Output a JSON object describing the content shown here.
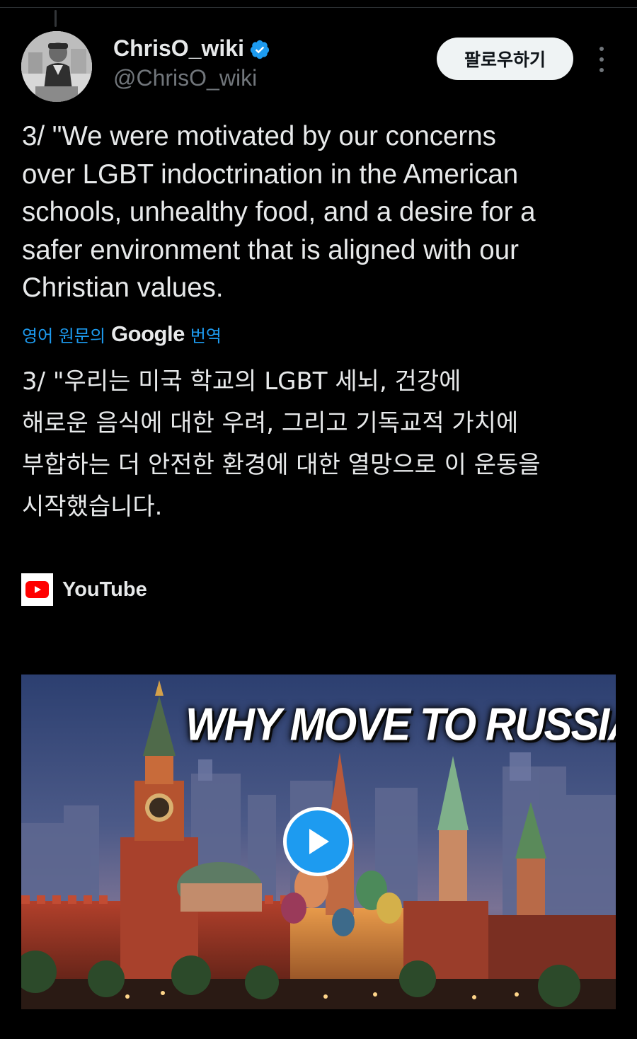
{
  "author": {
    "name": "ChrisO_wiki",
    "handle": "@ChrisO_wiki",
    "verified": true
  },
  "actions": {
    "follow_label": "팔로우하기",
    "more_icon": "more-vertical-icon"
  },
  "tweet": {
    "text": "3/ \"We were motivated by our concerns\nover LGBT indoctrination in the American\nschools, unhealthy food, and a desire for a\nsafer environment that is aligned with our\nChristian values.",
    "translate_prefix": "영어 원문의",
    "translate_brand": "Google",
    "translate_suffix": "번역",
    "translated_text": "3/ \"우리는 미국 학교의 LGBT 세뇌, 건강에\n해로운 음식에 대한 우려, 그리고 기독교적 가치에\n부합하는 더 안전한 환경에 대한 열망으로 이 운동을\n시작했습니다."
  },
  "card": {
    "source": "YouTube",
    "source_icon": "youtube-icon",
    "thumbnail_title": "WHY MOVE TO RUSSIA",
    "play_icon": "play-icon"
  },
  "colors": {
    "background": "#000000",
    "accent": "#1d9bf0",
    "text": "#e7e9ea",
    "muted": "#71767b",
    "youtube_red": "#ff0000"
  }
}
